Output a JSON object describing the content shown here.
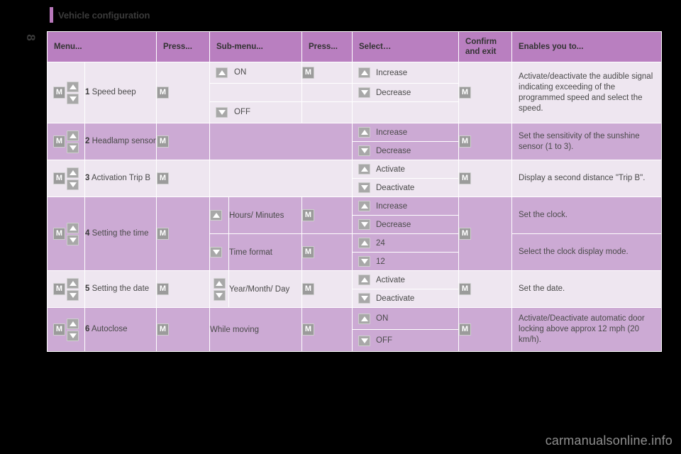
{
  "document": {
    "page_number": "8",
    "title": "Vehicle configuration",
    "watermark": "carmanualsonline.info"
  },
  "table": {
    "headers": {
      "menu": "Menu...",
      "press1": "Press...",
      "submenu": "Sub-menu...",
      "press2": "Press...",
      "select": "Select…",
      "confirm_line1": "Confirm",
      "confirm_line2": "and exit",
      "enables": "Enables you to..."
    },
    "icons": {
      "menu_button": "M",
      "press_button": "M",
      "confirm_button": "M",
      "up_arrow": "up-arrow-icon",
      "down_arrow": "down-arrow-icon"
    },
    "rows": [
      {
        "index": "1",
        "name": "Speed beep",
        "submenu_on": "ON",
        "submenu_off": "OFF",
        "select_up": "Increase",
        "select_down": "Decrease",
        "description": "Activate/deactivate the audible signal indicating exceeding of the programmed speed and select the speed."
      },
      {
        "index": "2",
        "name": "Headlamp sensor",
        "select_up": "Increase",
        "select_down": "Decrease",
        "description": "Set the sensitivity of the sunshine sensor (1 to 3)."
      },
      {
        "index": "3",
        "name": "Activation Trip B",
        "select_up": "Activate",
        "select_down": "Deactivate",
        "description": "Display a second distance \"Trip B\"."
      },
      {
        "index": "4",
        "name": "Setting the time",
        "submenu_a": "Hours/ Minutes",
        "submenu_b": "Time format",
        "select_a_up": "Increase",
        "select_a_down": "Decrease",
        "select_b_up": "24",
        "select_b_down": "12",
        "description_a": "Set the clock.",
        "description_b": "Select the clock display mode."
      },
      {
        "index": "5",
        "name": "Setting the date",
        "submenu": "Year/Month/ Day",
        "select_up": "Activate",
        "select_down": "Deactivate",
        "description": "Set the date."
      },
      {
        "index": "6",
        "name": "Autoclose",
        "submenu": "While moving",
        "select_up": "ON",
        "select_down": "OFF",
        "description": "Activate/Deactivate automatic door locking above approx 12 mph (20 km/h)."
      }
    ]
  },
  "colors": {
    "header_purple": "#b97fc0",
    "row_light": "#eee6f0",
    "row_dark": "#ccaad4",
    "accent_rule": "#b878bb"
  }
}
